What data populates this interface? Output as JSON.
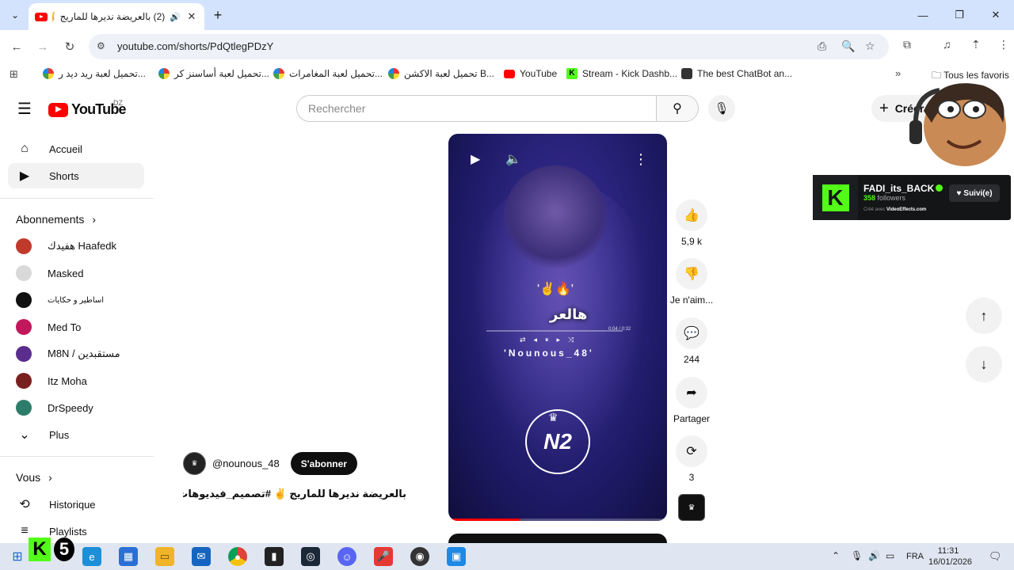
{
  "browser": {
    "tab_title": "(2) بالعريضة نديرها للماريج ✌️",
    "url": "youtube.com/shorts/PdQtlegPDzY",
    "bookmarks": [
      "تحميل لعبة ريد ديد ر...",
      "تحميل لعبة أساسنز كر...",
      "تحميل لعبة المغامرات...",
      "تحميل لعبة الاكشن B...",
      "YouTube",
      "Stream - Kick Dashb...",
      "The best ChatBot an..."
    ],
    "bookmarks_folder": "Tous les favoris"
  },
  "youtube": {
    "logo_text": "YouTube",
    "country_code": "DZ",
    "search_placeholder": "Rechercher",
    "create_label": "Créer",
    "nav": {
      "home": "Accueil",
      "shorts": "Shorts"
    },
    "subscriptions_heading": "Abonnements",
    "subscriptions": [
      {
        "name": "هفيدك Haafedk",
        "color": "#c0392b"
      },
      {
        "name": "Masked",
        "color": "#d9d9d9"
      },
      {
        "name": "اساطير و حكايات",
        "color": "#111111"
      },
      {
        "name": "Med To",
        "color": "#c2185b"
      },
      {
        "name": "M8N / مستقبدين",
        "color": "#5b2d8e"
      },
      {
        "name": "Itz Moha",
        "color": "#7a1f1f"
      },
      {
        "name": "DrSpeedy",
        "color": "#2e7d6b"
      }
    ],
    "more_label": "Plus",
    "you_heading": "Vous",
    "you_items": [
      "Historique",
      "Playlists"
    ],
    "short": {
      "overlay_emoji": "'✌️🔥'",
      "overlay_text": "هالعر",
      "overlay_time": "0:04 / 0:32",
      "overlay_name": "'Nounous_48'",
      "overlay_logo": "N2",
      "channel_handle": "@nounous_48",
      "subscribe_label": "S'abonner",
      "title": "بالعريضة نديرها للماريج ✌️ #تصميم_فيديوهات ...",
      "progress": 0.33
    },
    "actions": {
      "likes": "5,9 k",
      "dislike": "Je n'aim...",
      "comments": "244",
      "share": "Partager",
      "remix": "3"
    }
  },
  "stream_overlay": {
    "kick_name": "FADI_its_BACK",
    "followers_count": "358",
    "followers_label": "followers",
    "credit_prefix": "Créé avec",
    "credit_brand": "VideoEffects.com",
    "follow_label": "Suivi(e)",
    "kick_badge_number": "5"
  },
  "taskbar": {
    "language": "FRA",
    "time": "11:31",
    "date": "16/01/2026"
  }
}
